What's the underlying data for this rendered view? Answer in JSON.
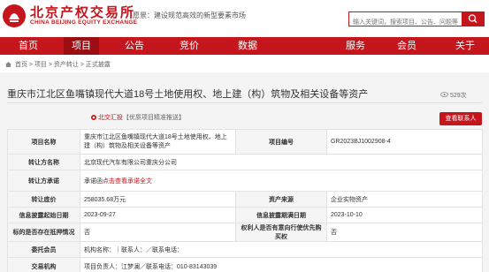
{
  "header": {
    "brand_cn": "北京产权交易所",
    "brand_en": "CHINA BEIJING EQUITY EXCHANGE",
    "slogan": "愿景：建设规范高效的新型要素市场",
    "search_placeholder": "输入关键词，搜索项目、公告、问题等"
  },
  "nav": {
    "items": [
      "首页",
      "项目",
      "公告",
      "竞价",
      "数据",
      "服务",
      "会员",
      "关于"
    ],
    "active": "项目"
  },
  "breadcrumb": [
    "首页",
    "项目",
    "资产转让",
    "正式披露"
  ],
  "project": {
    "title": "重庆市江北区鱼嘴镇现代大道18号土地使用权、地上建（构）筑物及相关设备等资产",
    "views": "529次",
    "source_name": "北交汇投",
    "source_note": "【优质项目精准推送】",
    "action_button": "查看联系人"
  },
  "table": {
    "rows": [
      {
        "k1": "项目名称",
        "v1": "重庆市江北区鱼嘴镇现代大道18号土地使用权、地上建（构）筑物及相关设备等资产",
        "k2": "项目编号",
        "v2": "GR2023BJ1002908-4"
      },
      {
        "k1": "转让方名称",
        "v1": "北京现代汽车有限公司重庆分公司"
      },
      {
        "k1": "转让方承诺",
        "v1_plain": "承诺函",
        "v1_link": "点击查看承诺全文"
      },
      {
        "k1": "转让底价",
        "v1": "258035.68万元",
        "k2": "资产来源",
        "v2": "企业实物资产"
      },
      {
        "k1": "信息披露起始日期",
        "v1": "2023-09-27",
        "k2": "信息披露期满日期",
        "v2": "2023-10-10"
      },
      {
        "k1": "标的是否存在抵押情况",
        "v1": "否",
        "k2": "权利人是否有意向行使优先购买权",
        "v2": "否"
      },
      {
        "k1": "委托会员",
        "v1": "机构名称：｜联系人：／联系电话："
      },
      {
        "k1": "交易机构",
        "v1": "项目负责人：江梦澜／联系电话：010-83143039"
      }
    ]
  },
  "colors": {
    "brand_red": "#c4161c",
    "nav_active": "#9b0d12"
  }
}
